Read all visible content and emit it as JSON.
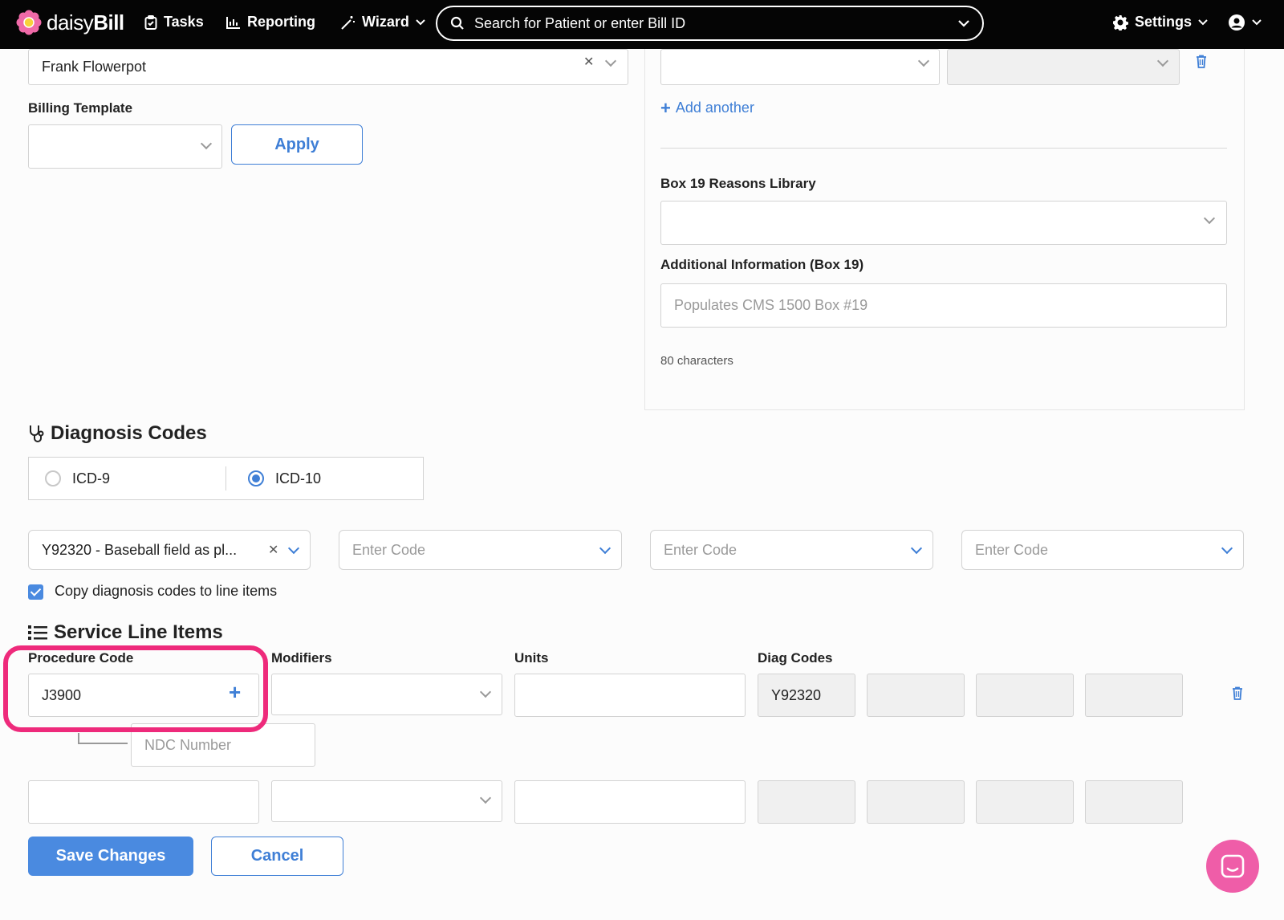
{
  "nav": {
    "brand_light": "daisy",
    "brand_bold": "Bill",
    "tasks": "Tasks",
    "reporting": "Reporting",
    "wizard": "Wizard",
    "search_placeholder": "Search for Patient or enter Bill ID",
    "settings": "Settings"
  },
  "top_left": {
    "provider_value": "Frank Flowerpot",
    "billing_template_label": "Billing Template",
    "apply_label": "Apply"
  },
  "right_panel": {
    "add_another": "Add another",
    "box19_library_label": "Box 19 Reasons Library",
    "additional_info_label": "Additional Information (Box 19)",
    "additional_info_placeholder": "Populates CMS 1500 Box #19",
    "char_count": "80 characters"
  },
  "diagnosis": {
    "title": "Diagnosis Codes",
    "icd9": "ICD-9",
    "icd10": "ICD-10",
    "selected": "ICD-10",
    "code1": "Y92320 - Baseball field as pl...",
    "code_placeholder": "Enter Code",
    "copy_label": "Copy diagnosis codes to line items",
    "copy_checked": true
  },
  "service_lines": {
    "title": "Service Line Items",
    "headers": {
      "procedure": "Procedure Code",
      "modifiers": "Modifiers",
      "units": "Units",
      "diag": "Diag Codes"
    },
    "row1": {
      "procedure": "J3900",
      "diag1": "Y92320",
      "ndc_placeholder": "NDC Number"
    }
  },
  "actions": {
    "save": "Save Changes",
    "cancel": "Cancel"
  },
  "colors": {
    "accent": "#3f7fd6",
    "highlight": "#ee2a7b",
    "chat": "#ef5da8"
  }
}
